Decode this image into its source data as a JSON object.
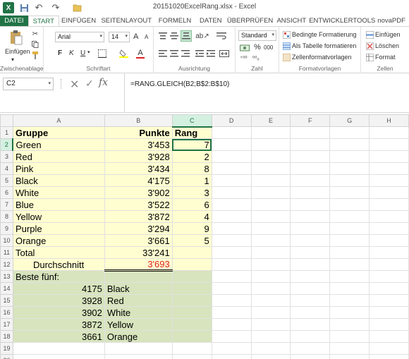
{
  "window": {
    "title": "20151020ExcelRang.xlsx - Excel",
    "app_logo": "X"
  },
  "tabs": [
    "DATEI",
    "START",
    "EINFÜGEN",
    "SEITENLAYOUT",
    "FORMELN",
    "DATEN",
    "ÜBERPRÜFEN",
    "ANSICHT",
    "ENTWICKLERTOOLS",
    "novaPDF"
  ],
  "ribbon": {
    "clipboard": {
      "paste_label": "Einfügen",
      "group_label": "Zwischenablage"
    },
    "font": {
      "name": "Arial",
      "size": "14",
      "bold": "F",
      "italic": "K",
      "underline": "U",
      "grow": "A",
      "shrink": "A",
      "group_label": "Schriftart"
    },
    "alignment": {
      "group_label": "Ausrichtung"
    },
    "number": {
      "format": "Standard",
      "percent": "%",
      "thousands": "000",
      "group_label": "Zahl"
    },
    "styles": {
      "conditional": "Bedingte Formatierung",
      "as_table": "Als Tabelle formatieren",
      "cell_styles": "Zellenformatvorlagen",
      "group_label": "Formatvorlagen"
    },
    "cells": {
      "insert": "Einfügen",
      "delete": "Löschen",
      "format": "Format",
      "group_label": "Zellen"
    }
  },
  "formula_bar": {
    "name_box": "C2",
    "formula": "=RANG.GLEICH(B2;B$2:B$10)"
  },
  "sheet": {
    "columns": [
      "A",
      "B",
      "C",
      "D",
      "E",
      "F",
      "G",
      "H"
    ],
    "selected_column": "C",
    "selected_row": "2",
    "rows": [
      {
        "n": "1",
        "a": "Gruppe",
        "b": "Punkte",
        "c": "Rang"
      },
      {
        "n": "2",
        "a": "Green",
        "b": "3'453",
        "c": "7"
      },
      {
        "n": "3",
        "a": "Red",
        "b": "3'928",
        "c": "2"
      },
      {
        "n": "4",
        "a": "Pink",
        "b": "3'434",
        "c": "8"
      },
      {
        "n": "5",
        "a": "Black",
        "b": "4'175",
        "c": "1"
      },
      {
        "n": "6",
        "a": "White",
        "b": "3'902",
        "c": "3"
      },
      {
        "n": "7",
        "a": "Blue",
        "b": "3'522",
        "c": "6"
      },
      {
        "n": "8",
        "a": "Yellow",
        "b": "3'872",
        "c": "4"
      },
      {
        "n": "9",
        "a": "Purple",
        "b": "3'294",
        "c": "9"
      },
      {
        "n": "10",
        "a": "Orange",
        "b": "3'661",
        "c": "5"
      },
      {
        "n": "11",
        "a": "Total",
        "b": "33'241",
        "c": ""
      },
      {
        "n": "12",
        "a": "Durchschnitt",
        "b": "3'693",
        "c": ""
      },
      {
        "n": "13",
        "a": "Beste fünf:",
        "b": "",
        "c": ""
      },
      {
        "n": "14",
        "a": "4175",
        "b": "Black",
        "c": ""
      },
      {
        "n": "15",
        "a": "3928",
        "b": "Red",
        "c": ""
      },
      {
        "n": "16",
        "a": "3902",
        "b": "White",
        "c": ""
      },
      {
        "n": "17",
        "a": "3872",
        "b": "Yellow",
        "c": ""
      },
      {
        "n": "18",
        "a": "3661",
        "b": "Orange",
        "c": ""
      },
      {
        "n": "19",
        "a": "",
        "b": "",
        "c": ""
      },
      {
        "n": "20",
        "a": "",
        "b": "",
        "c": ""
      }
    ]
  },
  "colors": {
    "excel_green": "#217346",
    "yellow_fill": "#fffed0",
    "green_fill": "#d7e4bd",
    "average_red": "#e02020"
  }
}
